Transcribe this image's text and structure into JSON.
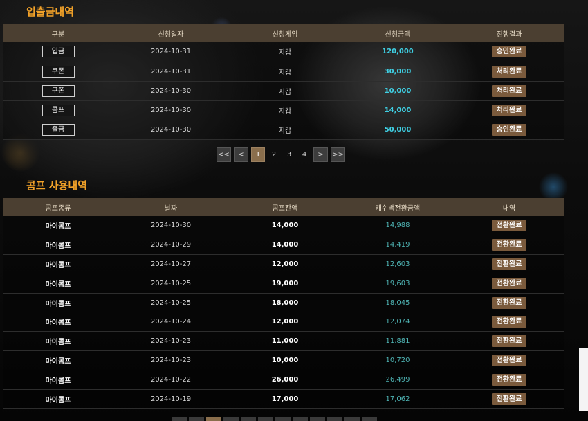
{
  "deposit_section": {
    "title": "입출금내역",
    "headers": [
      "구분",
      "신청일자",
      "신청게임",
      "신청금액",
      "진행결과"
    ],
    "rows": [
      {
        "type": "입금",
        "date": "2024-10-31",
        "game": "지갑",
        "amount": "120,000",
        "status": "승인완료"
      },
      {
        "type": "쿠폰",
        "date": "2024-10-31",
        "game": "지갑",
        "amount": "30,000",
        "status": "처리완료"
      },
      {
        "type": "쿠폰",
        "date": "2024-10-30",
        "game": "지갑",
        "amount": "10,000",
        "status": "처리완료"
      },
      {
        "type": "콤프",
        "date": "2024-10-30",
        "game": "지갑",
        "amount": "14,000",
        "status": "처리완료"
      },
      {
        "type": "출금",
        "date": "2024-10-30",
        "game": "지갑",
        "amount": "50,000",
        "status": "승인완료"
      }
    ],
    "pagination": {
      "first": "<<",
      "prev": "<",
      "pages": [
        "1",
        "2",
        "3",
        "4"
      ],
      "active_page": "1",
      "next": ">",
      "last": ">>"
    }
  },
  "comp_section": {
    "title": "콤프 사용내역",
    "headers": [
      "콤프종류",
      "날짜",
      "콤프잔액",
      "캐쉬백전환금액",
      "내역"
    ],
    "rows": [
      {
        "kind": "마이콤프",
        "date": "2024-10-30",
        "balance": "14,000",
        "cashback": "14,988",
        "status": "전환완료"
      },
      {
        "kind": "마이콤프",
        "date": "2024-10-29",
        "balance": "14,000",
        "cashback": "14,419",
        "status": "전환완료"
      },
      {
        "kind": "마이콤프",
        "date": "2024-10-27",
        "balance": "12,000",
        "cashback": "12,603",
        "status": "전환완료"
      },
      {
        "kind": "마이콤프",
        "date": "2024-10-25",
        "balance": "19,000",
        "cashback": "19,603",
        "status": "전환완료"
      },
      {
        "kind": "마이콤프",
        "date": "2024-10-25",
        "balance": "18,000",
        "cashback": "18,045",
        "status": "전환완료"
      },
      {
        "kind": "마이콤프",
        "date": "2024-10-24",
        "balance": "12,000",
        "cashback": "12,074",
        "status": "전환완료"
      },
      {
        "kind": "마이콤프",
        "date": "2024-10-23",
        "balance": "11,000",
        "cashback": "11,881",
        "status": "전환완료"
      },
      {
        "kind": "마이콤프",
        "date": "2024-10-23",
        "balance": "10,000",
        "cashback": "10,720",
        "status": "전환완료"
      },
      {
        "kind": "마이콤프",
        "date": "2024-10-22",
        "balance": "26,000",
        "cashback": "26,499",
        "status": "전환완료"
      },
      {
        "kind": "마이콤프",
        "date": "2024-10-19",
        "balance": "17,000",
        "cashback": "17,062",
        "status": "전환완료"
      }
    ]
  },
  "colors": {
    "accent_title": "#f2a229",
    "header_bar": "#4b3f31",
    "status_button": "#7a5a3c",
    "amount_cyan": "#3fd0e4",
    "cashback_teal": "#4fb5b5"
  }
}
